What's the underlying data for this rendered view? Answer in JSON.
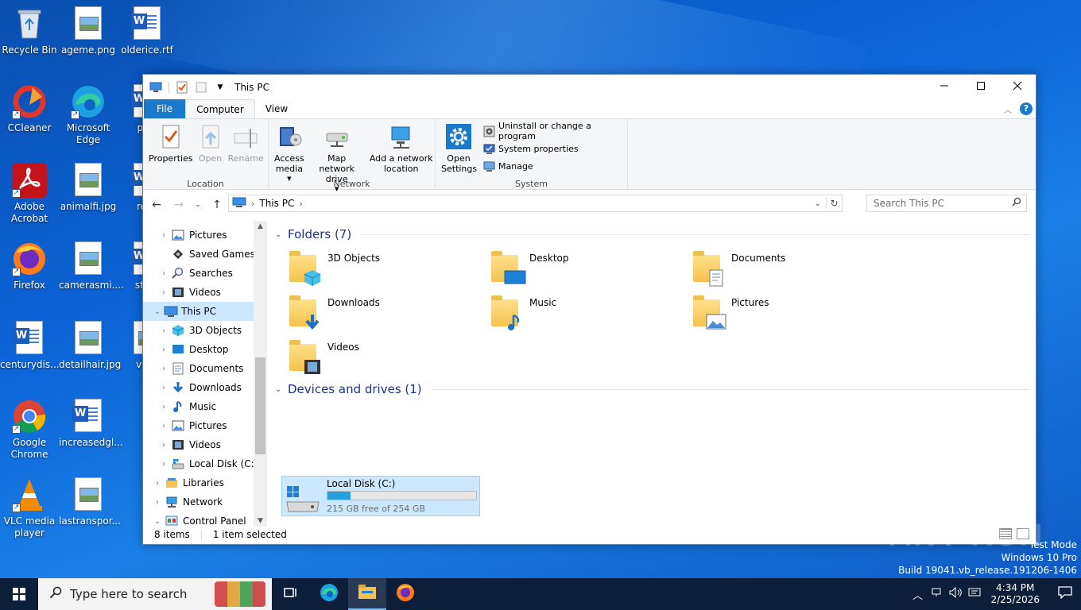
{
  "desktop": {
    "icons": [
      {
        "label": "Recycle Bin"
      },
      {
        "label": "ageme.png"
      },
      {
        "label": "olderice.rtf"
      },
      {
        "label": "CCleaner"
      },
      {
        "label": "Microsoft Edge"
      },
      {
        "label": "paic"
      },
      {
        "label": "Adobe Acrobat"
      },
      {
        "label": "animalfi.jpg"
      },
      {
        "label": "reco"
      },
      {
        "label": "Firefox"
      },
      {
        "label": "camerasmi...."
      },
      {
        "label": "store"
      },
      {
        "label": "centurydis..."
      },
      {
        "label": "detailhair.jpg"
      },
      {
        "label": "virtu"
      },
      {
        "label": "Google Chrome"
      },
      {
        "label": "increasedgl..."
      },
      {
        "label": "VLC media player"
      },
      {
        "label": "lastranspor..."
      }
    ]
  },
  "window": {
    "title": "This PC",
    "tabs": {
      "file": "File",
      "computer": "Computer",
      "view": "View"
    },
    "ribbon": {
      "location": {
        "name": "Location",
        "properties": "Properties",
        "open": "Open",
        "rename": "Rename"
      },
      "network": {
        "name": "Network",
        "access_media": "Access media",
        "map_drive": "Map network drive",
        "add_location": "Add a network location"
      },
      "system": {
        "name": "System",
        "open_settings": "Open Settings",
        "uninstall": "Uninstall or change a program",
        "system_properties": "System properties",
        "manage": "Manage"
      }
    },
    "address": {
      "crumb": "This PC"
    },
    "search": {
      "placeholder": "Search This PC"
    },
    "nav": [
      {
        "label": "Pictures"
      },
      {
        "label": "Saved Games"
      },
      {
        "label": "Searches"
      },
      {
        "label": "Videos"
      },
      {
        "label": "This PC"
      },
      {
        "label": "3D Objects"
      },
      {
        "label": "Desktop"
      },
      {
        "label": "Documents"
      },
      {
        "label": "Downloads"
      },
      {
        "label": "Music"
      },
      {
        "label": "Pictures"
      },
      {
        "label": "Videos"
      },
      {
        "label": "Local Disk (C:)"
      },
      {
        "label": "Libraries"
      },
      {
        "label": "Network"
      },
      {
        "label": "Control Panel"
      }
    ],
    "folders_header": "Folders (7)",
    "folders": [
      {
        "label": "3D Objects"
      },
      {
        "label": "Desktop"
      },
      {
        "label": "Documents"
      },
      {
        "label": "Downloads"
      },
      {
        "label": "Music"
      },
      {
        "label": "Pictures"
      },
      {
        "label": "Videos"
      }
    ],
    "devices_header": "Devices and drives (1)",
    "drive": {
      "name": "Local Disk (C:)",
      "free_text": "215 GB free of 254 GB",
      "used_fraction": 0.154
    },
    "status": {
      "items": "8 items",
      "selected": "1 item selected"
    }
  },
  "watermark": "ANY RUN",
  "testmode": {
    "line1": "Test Mode",
    "line2": "Windows 10 Pro",
    "line3": "Build 19041.vb_release.191206-1406"
  },
  "taskbar": {
    "search_placeholder": "Type here to search",
    "time": "4:34 PM",
    "date": "2/25/2026"
  }
}
